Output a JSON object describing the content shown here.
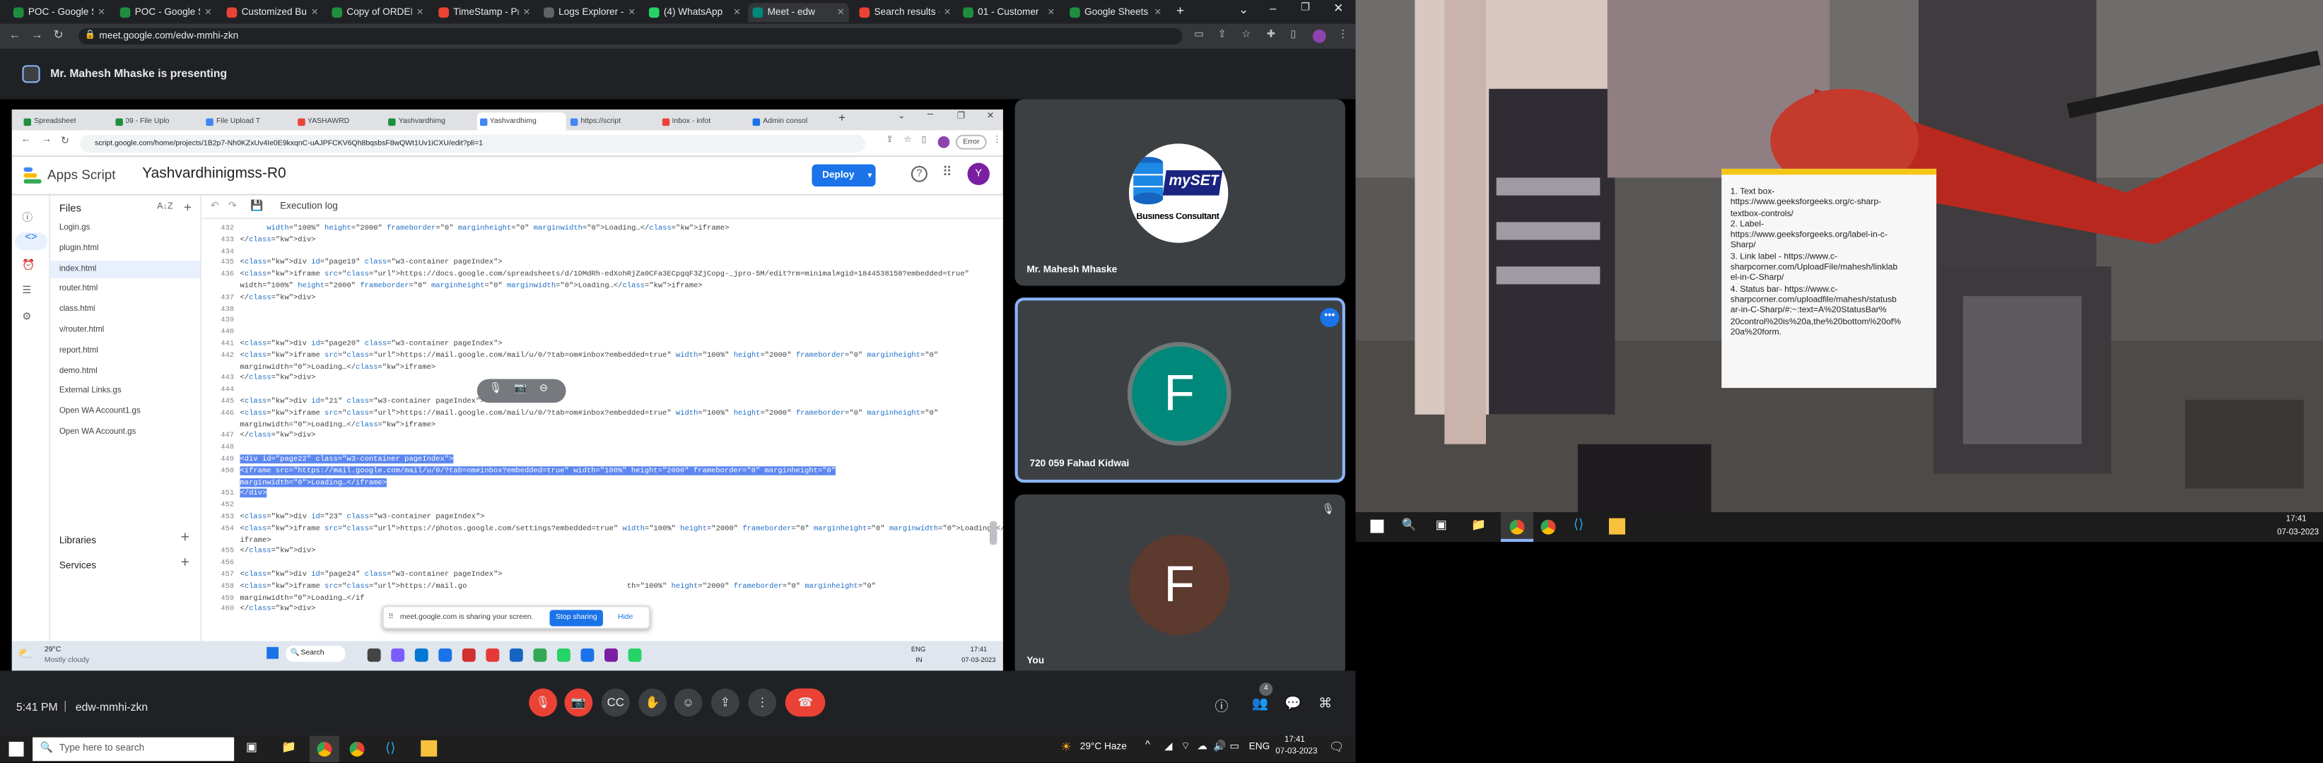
{
  "browser": {
    "tabs": [
      {
        "label": "POC - Google Sh",
        "color": "#1e8e3e"
      },
      {
        "label": "POC - Google Sh",
        "color": "#1e8e3e"
      },
      {
        "label": "Customized Bu",
        "color": "#ea4335"
      },
      {
        "label": "Copy of ORDER",
        "color": "#1e8e3e"
      },
      {
        "label": "TimeStamp - Pr",
        "color": "#ea4335"
      },
      {
        "label": "Logs Explorer -",
        "color": "#5f6368"
      },
      {
        "label": "(4) WhatsApp",
        "color": "#25d366"
      },
      {
        "label": "Meet - edw",
        "color": "#00897b"
      },
      {
        "label": "Search results -",
        "color": "#ea4335"
      },
      {
        "label": "01 - Customer",
        "color": "#1e8e3e"
      },
      {
        "label": "Google Sheets",
        "color": "#1e8e3e"
      }
    ],
    "url": "meet.google.com/edw-mmhi-zkn"
  },
  "presenting_banner": "Mr. Mahesh Mhaske is presenting",
  "shared": {
    "tabs": [
      "Spreadsheet",
      "09 - File Uplo",
      "File Upload T",
      "YASHAWRD",
      "Yashvardhimg",
      "Yashvardhimg",
      "https://script",
      "Inbox - infot",
      "Admin consol"
    ],
    "url": "script.google.com/home/projects/1B2p7-Nh0KZxUv4Ie0E9kxqnC-uAJPFCKV6Qh8bqsbsF8wQWt1Uv1iCXU/edit?pli=1",
    "error_label": "Error",
    "app_name": "Apps Script",
    "project": "Yashvardhinigmss-R0",
    "deploy_label": "Deploy",
    "avatar": "Y",
    "execution_log": "Execution log",
    "files_title": "Files",
    "files": [
      "Login.gs",
      "plugin.html",
      "index.html",
      "router.html",
      "class.html",
      "v/router.html",
      "report.html",
      "demo.html",
      "External Links.gs",
      "Open WA Account1.gs",
      "Open WA Account.gs"
    ],
    "libraries": "Libraries",
    "services": "Services",
    "code_lines": [
      {
        "n": "432",
        "t": "      width=\"100%\" height=\"2000\" frameborder=\"0\" marginheight=\"0\" marginwidth=\"0\">Loading…</iframe>"
      },
      {
        "n": "433",
        "t": "</div>"
      },
      {
        "n": "434",
        "t": ""
      },
      {
        "n": "435",
        "t": "<div id=\"page19\" class=\"w3-container pageIndex\">"
      },
      {
        "n": "436",
        "t": "<iframe src=\"https://docs.google.com/spreadsheets/d/1DMdRh-edXohRjZa0CFa3ECpgqF3ZjCopg-_jpro-5M/edit?rm=minimal#gid=1844538158?embedded=true\""
      },
      {
        "n": "",
        "t": "width=\"100%\" height=\"2000\" frameborder=\"0\" marginheight=\"0\" marginwidth=\"0\">Loading…</iframe>"
      },
      {
        "n": "437",
        "t": "</div>"
      },
      {
        "n": "438",
        "t": ""
      },
      {
        "n": "439",
        "t": ""
      },
      {
        "n": "440",
        "t": ""
      },
      {
        "n": "441",
        "t": "<div id=\"page20\" class=\"w3-container pageIndex\">"
      },
      {
        "n": "442",
        "t": "<iframe src=\"https://mail.google.com/mail/u/0/?tab=om#inbox?embedded=true\" width=\"100%\" height=\"2000\" frameborder=\"0\" marginheight=\"0\""
      },
      {
        "n": "",
        "t": "marginwidth=\"0\">Loading…</iframe>"
      },
      {
        "n": "443",
        "t": "</div>"
      },
      {
        "n": "444",
        "t": ""
      },
      {
        "n": "445",
        "t": "<div id=\"21\" class=\"w3-container pageIndex\">"
      },
      {
        "n": "446",
        "t": "<iframe src=\"https://mail.google.com/mail/u/0/?tab=om#inbox?embedded=true\" width=\"100%\" height=\"2000\" frameborder=\"0\" marginheight=\"0\""
      },
      {
        "n": "",
        "t": "marginwidth=\"0\">Loading…</iframe>"
      },
      {
        "n": "447",
        "t": "</div>"
      },
      {
        "n": "448",
        "t": ""
      },
      {
        "n": "449",
        "t": "<div id=\"page22\" class=\"w3-container pageIndex\">"
      },
      {
        "n": "450",
        "t": "<iframe src=\"https://mail.google.com/mail/u/0/?tab=om#inbox?embedded=true\" width=\"100%\" height=\"2000\" frameborder=\"0\" marginheight=\"0\""
      },
      {
        "n": "",
        "t": "marginwidth=\"0\">Loading…</iframe>"
      },
      {
        "n": "451",
        "t": "</div>"
      },
      {
        "n": "452",
        "t": ""
      },
      {
        "n": "453",
        "t": "<div id=\"23\" class=\"w3-container pageIndex\">"
      },
      {
        "n": "454",
        "t": "<iframe src=\"https://photos.google.com/settings?embedded=true\" width=\"100%\" height=\"2000\" frameborder=\"0\" marginheight=\"0\" marginwidth=\"0\">Loading…</"
      },
      {
        "n": "",
        "t": "iframe>"
      },
      {
        "n": "455",
        "t": "</div>"
      },
      {
        "n": "456",
        "t": ""
      },
      {
        "n": "457",
        "t": "<div id=\"page24\" class=\"w3-container pageIndex\">"
      },
      {
        "n": "458",
        "t": "<iframe src=\"https://mail.go                                    th=\"100%\" height=\"2000\" frameborder=\"0\" marginheight=\"0\""
      },
      {
        "n": "459",
        "t": "marginwidth=\"0\">Loading…</if"
      },
      {
        "n": "460",
        "t": "</div>"
      }
    ],
    "sharing_text": "meet.google.com is sharing your screen.",
    "stop_sharing": "Stop sharing",
    "hide": "Hide",
    "weather_temp": "29°C",
    "weather_desc": "Mostly cloudy",
    "search": "Search",
    "lang": "ENG",
    "lang2": "IN",
    "time": "17:41",
    "date": "07-03-2023"
  },
  "participants": [
    {
      "name": "Mr. Mahesh Mhaske",
      "logo_text": "mySET",
      "logo_sub": "Business Consultant"
    },
    {
      "name": "720 059 Fahad Kidwai",
      "initial": "F",
      "color": "#00897b"
    },
    {
      "name": "You",
      "initial": "F",
      "color": "#5d3a2e"
    }
  ],
  "meeting": {
    "time": "5:41 PM",
    "code": "edw-mmhi-zkn",
    "people_count": "4"
  },
  "taskbar": {
    "search_placeholder": "Type here to search",
    "weather": "29°C Haze",
    "lang": "ENG",
    "time": "17:41",
    "date": "07-03-2023"
  },
  "remote": {
    "time": "17:41",
    "date": "07-03-2023",
    "note_lines": [
      "1.        Text box-",
      "https://www.geeksforgeeks.org/c-sharp-",
      "textbox-controls/",
      "2.        Label-",
      "https://www.geeksforgeeks.org/label-in-c-",
      "Sharp/",
      "3.        Link label - https://www.c-",
      "sharpcorner.com/UploadFile/mahesh/linklab",
      "el-in-C-Sharp/",
      "4.        Status bar- https://www.c-",
      "sharpcorner.com/uploadfile/mahesh/statusb",
      "ar-in-C-Sharp/#:~:text=A%20StatusBar%",
      "20control%20is%20a,the%20bottom%20of%",
      "20a%20form."
    ]
  }
}
